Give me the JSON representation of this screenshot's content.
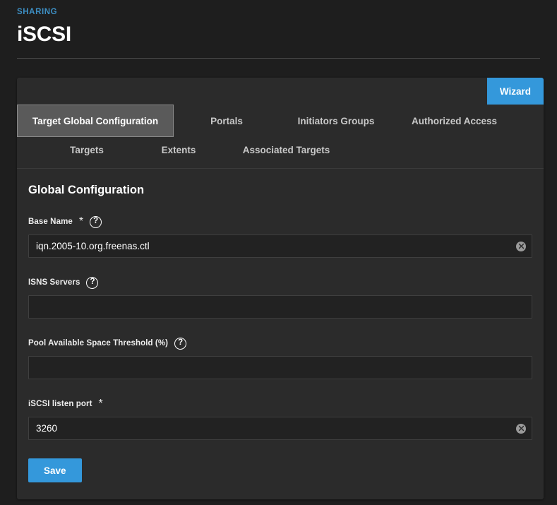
{
  "header": {
    "breadcrumb": "SHARING",
    "title": "iSCSI"
  },
  "card": {
    "wizard_label": "Wizard",
    "tabs_row1": [
      {
        "label": "Target Global Configuration",
        "active": true
      },
      {
        "label": "Portals",
        "active": false
      },
      {
        "label": "Initiators Groups",
        "active": false
      },
      {
        "label": "Authorized Access",
        "active": false
      }
    ],
    "tabs_row2": [
      {
        "label": "Targets",
        "active": false
      },
      {
        "label": "Extents",
        "active": false
      },
      {
        "label": "Associated Targets",
        "active": false
      }
    ],
    "section_title": "Global Configuration",
    "fields": [
      {
        "label": "Base Name",
        "required": true,
        "required_marker": "*",
        "has_help": true,
        "help_glyph": "?",
        "value": "iqn.2005-10.org.freenas.ctl",
        "placeholder": "",
        "has_clear": true
      },
      {
        "label": "ISNS Servers",
        "required": false,
        "required_marker": "",
        "has_help": true,
        "help_glyph": "?",
        "value": "",
        "placeholder": "",
        "has_clear": false
      },
      {
        "label": "Pool Available Space Threshold (%)",
        "required": false,
        "required_marker": "",
        "has_help": true,
        "help_glyph": "?",
        "value": "",
        "placeholder": "",
        "has_clear": false
      },
      {
        "label": "iSCSI listen port",
        "required": true,
        "required_marker": "*",
        "has_help": false,
        "help_glyph": "",
        "value": "3260",
        "placeholder": "",
        "has_clear": true
      }
    ],
    "save_label": "Save"
  },
  "colors": {
    "accent_blue": "#3498db",
    "breadcrumb_blue": "#3d8fc4",
    "page_bg": "#1e1e1e",
    "card_bg": "#2b2b2b",
    "input_bg": "#222222",
    "active_tab_bg": "#5a5a5a"
  }
}
